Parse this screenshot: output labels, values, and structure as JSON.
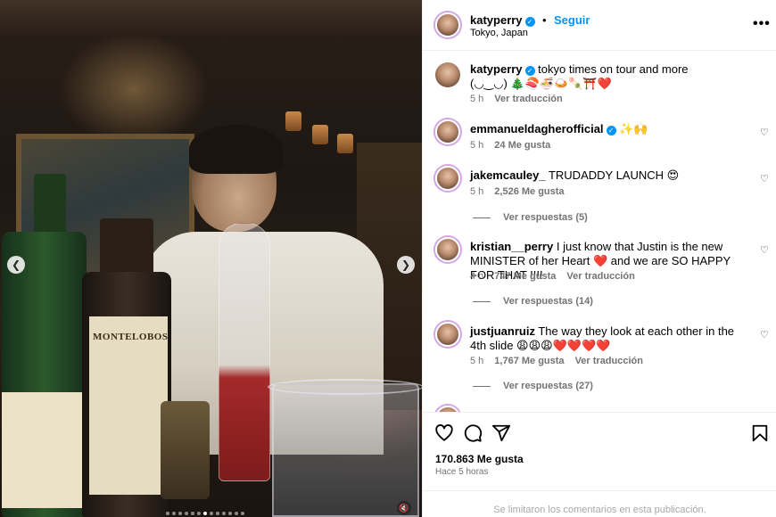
{
  "post": {
    "username": "katyperry",
    "follow_label": "Seguir",
    "location": "Tokyo, Japan",
    "more_icon": "more-icon",
    "image_label": "MONTELOBOS",
    "caption": {
      "username": "katyperry",
      "text": "tokyo times on tour and more",
      "text2": "(◡‿◡) 🎄🍣🍜🍛🍡⛩️❤️",
      "time": "5 h",
      "translate": "Ver traducción"
    },
    "likes": "170.863 Me gusta",
    "posted": "Hace 5 horas",
    "comments_disabled": "Se limitaron los comentarios en esta publicación."
  },
  "comments": [
    {
      "username": "emmanueldagherofficial",
      "text": "✨🙌",
      "time": "5 h",
      "likes": "24 Me gusta",
      "translate": ""
    },
    {
      "username": "jakemcauley_",
      "text": "TRUDADDY LAUNCH 😍",
      "time": "5 h",
      "likes": "2,526 Me gusta",
      "translate": "",
      "replies": "Ver respuestas (5)"
    },
    {
      "username": "kristian__perry",
      "text": "I just know that Justin is the new MINISTER of her Heart ❤️ and we are SO HAPPY FOR THAT !!!!",
      "time": "4 h",
      "likes": "747 Me gusta",
      "translate": "Ver traducción",
      "replies": "Ver respuestas (14)"
    },
    {
      "username": "justjuanruiz",
      "text": "The way they look at each other in the 4th slide 😩😩😩❤️❤️❤️❤️",
      "time": "5 h",
      "likes": "1,767 Me gusta",
      "translate": "Ver traducción",
      "replies": "Ver respuestas (27)"
    }
  ],
  "carousel": {
    "prev_icon": "chevron-left-icon",
    "next_icon": "chevron-right-icon",
    "mute_icon": "muted-speaker-icon",
    "slide_count": 13,
    "active_slide": 7
  },
  "colors": {
    "accent": "#0095f6",
    "muted_text": "#737373",
    "divider": "#efefef"
  }
}
